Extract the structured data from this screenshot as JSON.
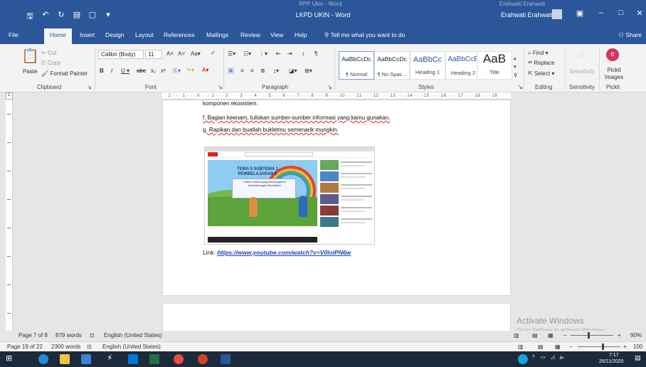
{
  "window": {
    "background_title": "RPP Ukin - Word",
    "background_user": "Erahwati Erahwati",
    "title": "LKPD UKIN - Word",
    "user": "Erahwati Erahwati"
  },
  "tabs": [
    {
      "label": "File"
    },
    {
      "label": "Home"
    },
    {
      "label": "Insert"
    },
    {
      "label": "Design"
    },
    {
      "label": "Layout"
    },
    {
      "label": "References"
    },
    {
      "label": "Mailings"
    },
    {
      "label": "Review"
    },
    {
      "label": "View"
    },
    {
      "label": "Help"
    }
  ],
  "tell_me": "Tell me what you want to do",
  "share": "Share",
  "clipboard": {
    "label": "Clipboard",
    "paste": "Paste",
    "cut": "Cut",
    "copy": "Copy",
    "format_painter": "Format Painter"
  },
  "font": {
    "label": "Font",
    "family": "Calibri (Body)",
    "size": "11"
  },
  "paragraph": {
    "label": "Paragraph"
  },
  "styles": {
    "label": "Styles",
    "items": [
      {
        "preview": "AaBbCcDc",
        "name": "¶ Normal"
      },
      {
        "preview": "AaBbCcDc",
        "name": "¶ No Spac..."
      },
      {
        "preview": "AaBbCc",
        "name": "Heading 1"
      },
      {
        "preview": "AaBbCcE",
        "name": "Heading 2"
      },
      {
        "preview": "AaB",
        "name": "Title"
      }
    ]
  },
  "editing": {
    "label": "Editing",
    "find": "Find",
    "replace": "Replace",
    "select": "Select"
  },
  "sensitivity": {
    "label": "Sensitivity",
    "button": "Sensitivity"
  },
  "pickit": {
    "label": "Pickit",
    "button": "Pickit Images"
  },
  "ruler": {
    "text": "· 2 · · · 1 · · · X · · · 1 · · · 2 · · · 3 · · · 4 · · · 5 · · · 6 · · · 7 · · · 8 · · · 9 · · · 10 · · · 11 · · · 12 · · · 13 · · · 14 · · · 15 · · · 16 · · · 17 · · · 18 · · · 19"
  },
  "document": {
    "lines": [
      {
        "text": "komponen ekosistem."
      },
      {
        "text": "f. Bagian keenam, tuliskan sumber-sumber informasi yang kamu gunakan."
      },
      {
        "text": "g. Rapikan dan buatlah bukletmu semenarik mungkin."
      }
    ],
    "image": {
      "heading": "TEMA 5 SUBTEMA 1 PEMBELAJARAN 6",
      "caption": "Faktor-Faktor yang Memengaruhi Keseimbangan Ekosistem"
    },
    "link_label": "Link:",
    "link_url": "https://www.youtube.com/watch?v=V0loIPN6w"
  },
  "status_front": {
    "page": "Page 7 of 8",
    "words": "879 words",
    "language": "English (United States)",
    "zoom": "90%"
  },
  "status_back": {
    "page": "Page 19 of 22",
    "words": "2300 words",
    "language": "English (United States)",
    "zoom": "100"
  },
  "activate": {
    "title": "Activate Windows",
    "subtitle": "Go to Settings to activate Windows."
  },
  "taskbar": {
    "time": "7:17",
    "date": "26/11/2020"
  }
}
